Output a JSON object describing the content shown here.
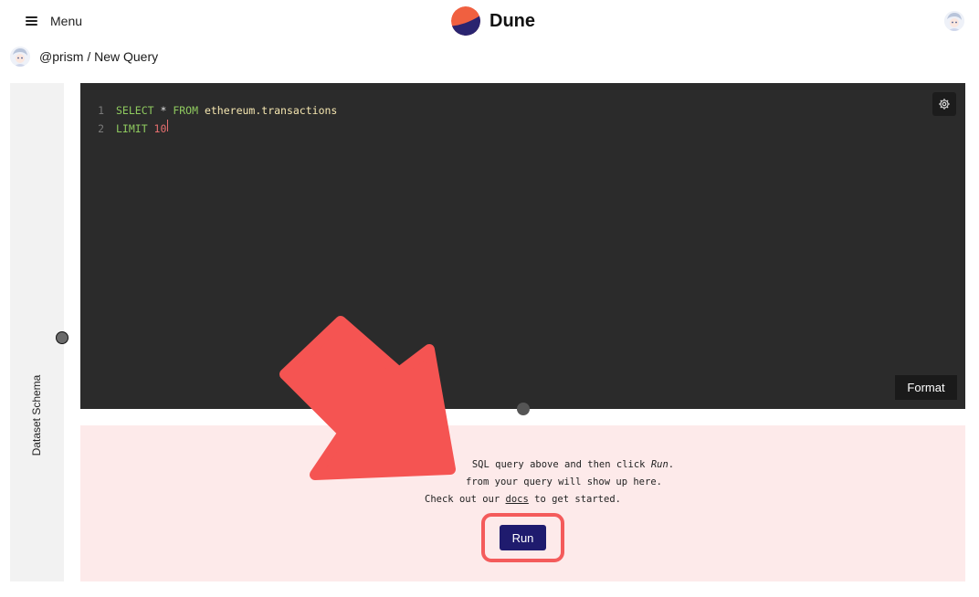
{
  "header": {
    "menu_label": "Menu",
    "brand_name": "Dune",
    "brand_colors": [
      "#f06040",
      "#2a2470"
    ]
  },
  "breadcrumb": {
    "user": "@prism",
    "separator": " / ",
    "page": "New Query"
  },
  "sidebar": {
    "label": "Dataset Schema"
  },
  "editor": {
    "lines": [
      {
        "num": "1",
        "kw1": "SELECT",
        "op": " * ",
        "kw2": "FROM",
        "rest": " ethereum.transactions"
      },
      {
        "num": "2",
        "kw1": "LIMIT",
        "val": " 10"
      }
    ],
    "format_label": "Format"
  },
  "results": {
    "line1": "SQL query above and then click ",
    "line1_em": "Run",
    "line1_end": ".",
    "line2": "from your query will show up here.",
    "line3_pre": "Check out our ",
    "line3_link": "docs",
    "line3_post": " to get started.",
    "run_label": "Run"
  },
  "colors": {
    "accent_run": "#1f1b6e",
    "highlight": "#f45b5b",
    "results_bg": "#fdeaea",
    "editor_bg": "#2b2b2b"
  }
}
